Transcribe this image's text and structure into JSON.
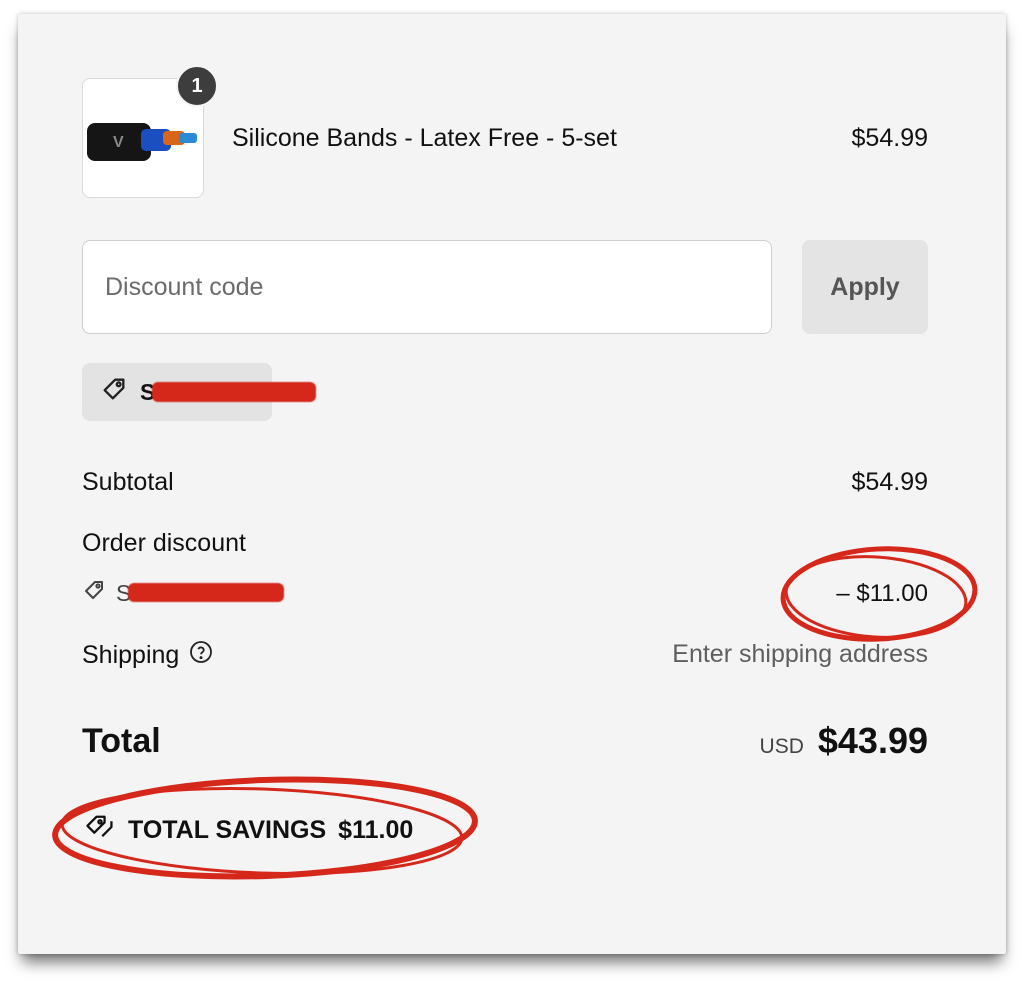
{
  "product": {
    "name": "Silicone Bands - Latex Free - 5-set",
    "price": "$54.99",
    "quantity": "1"
  },
  "discount": {
    "placeholder": "Discount code",
    "apply_label": "Apply",
    "applied_code_visible": "S"
  },
  "summary": {
    "subtotal_label": "Subtotal",
    "subtotal_value": "$54.99",
    "order_discount_label": "Order discount",
    "order_discount_code_visible": "S",
    "order_discount_value": "– $11.00",
    "shipping_label": "Shipping",
    "shipping_value": "Enter shipping address",
    "total_label": "Total",
    "currency": "USD",
    "total_value": "$43.99",
    "savings_label": "TOTAL SAVINGS",
    "savings_value": "$11.00"
  },
  "colors": {
    "annotation_red": "#d5281b",
    "panel_bg": "#f4f4f4"
  }
}
